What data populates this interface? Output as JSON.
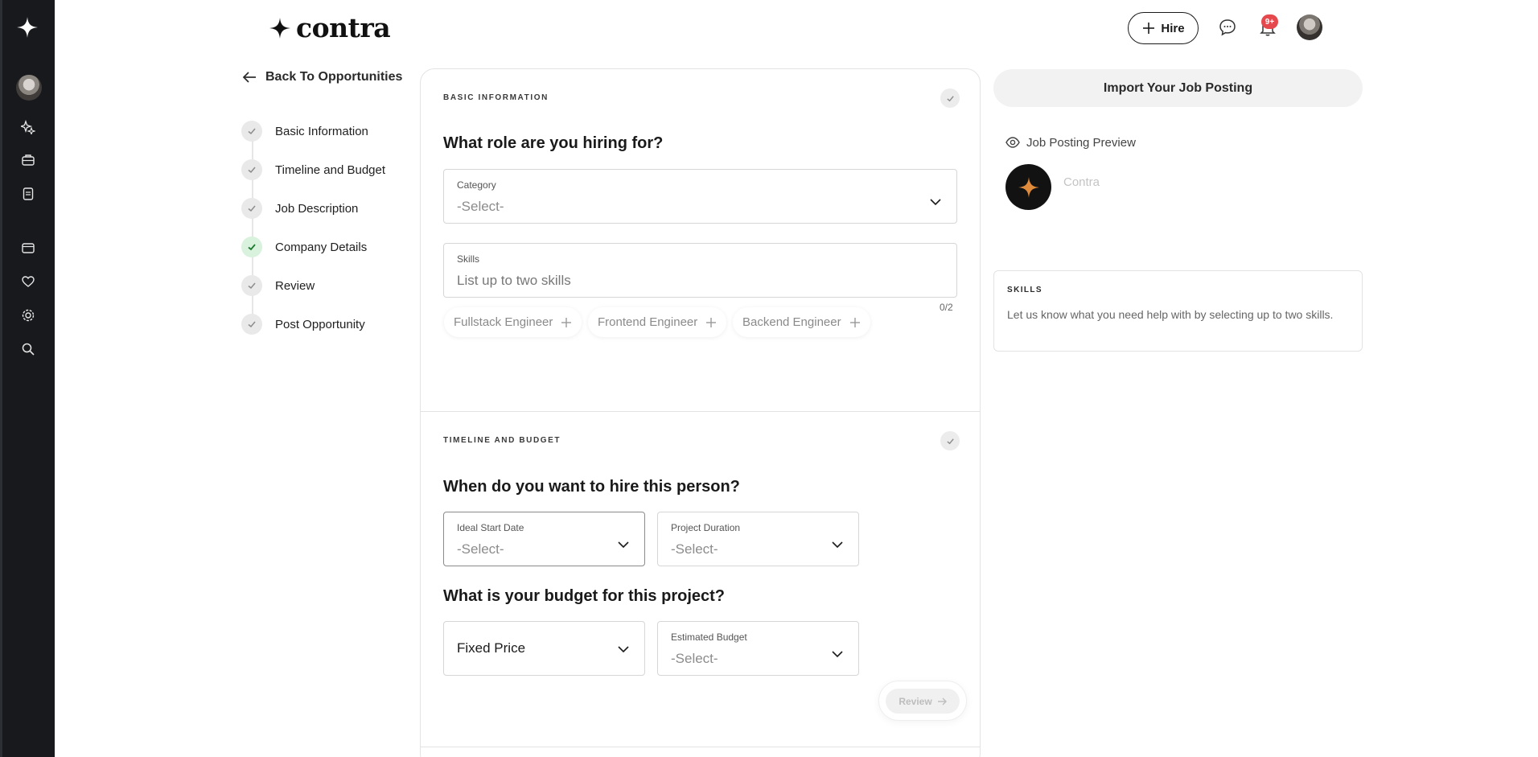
{
  "header": {
    "brand": "contra",
    "hire_label": "Hire",
    "notification_badge": "9+"
  },
  "sidebar_icons": [
    "sparkle-icon",
    "briefcase-icon",
    "document-icon",
    "wallet-icon",
    "heart-icon",
    "settings-icon",
    "search-icon"
  ],
  "steps": {
    "back_label": "Back To Opportunities",
    "items": [
      {
        "label": "Basic Information",
        "state": "pending"
      },
      {
        "label": "Timeline and Budget",
        "state": "pending"
      },
      {
        "label": "Job Description",
        "state": "pending"
      },
      {
        "label": "Company Details",
        "state": "done"
      },
      {
        "label": "Review",
        "state": "pending"
      },
      {
        "label": "Post Opportunity",
        "state": "pending"
      }
    ]
  },
  "basic": {
    "section_label": "BASIC INFORMATION",
    "question": "What role are you hiring for?",
    "category": {
      "label": "Category",
      "value": "-Select-"
    },
    "skills": {
      "label": "Skills",
      "placeholder": "List up to two skills",
      "counter": "0/2"
    },
    "suggestions": [
      "Fullstack Engineer",
      "Frontend Engineer",
      "Backend Engineer"
    ]
  },
  "timeline": {
    "section_label": "TIMELINE AND BUDGET",
    "question": "When do you want to hire this person?",
    "start_date": {
      "label": "Ideal Start Date",
      "value": "-Select-"
    },
    "duration": {
      "label": "Project Duration",
      "value": "-Select-"
    },
    "budget_question": "What is your budget for this project?",
    "pricing": {
      "value": "Fixed Price"
    },
    "estimated": {
      "label": "Estimated Budget",
      "value": "-Select-"
    },
    "review_label": "Review"
  },
  "right": {
    "import_label": "Import Your Job Posting",
    "preview_label": "Job Posting Preview",
    "company_name": "Contra",
    "skills_label": "SKILLS",
    "skills_text": "Let us know what you need help with by selecting up to two skills."
  },
  "colors": {
    "rail": "#17191c",
    "accent_star": "#e08a3c",
    "done_step": "#d9f2dd",
    "badge": "#e5484d"
  }
}
